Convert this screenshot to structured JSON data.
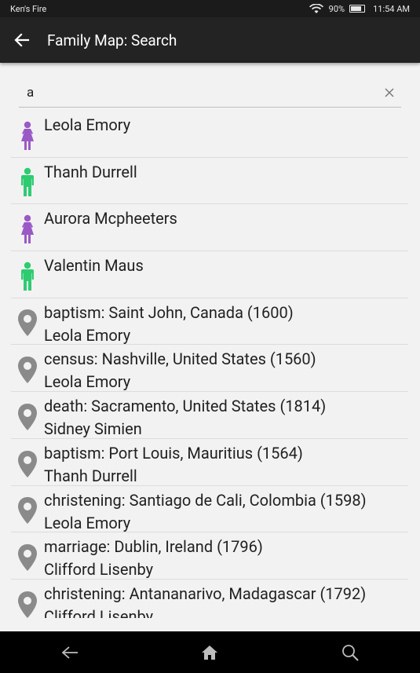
{
  "status_bar": {
    "carrier": "Ken's Fire",
    "battery": "90%",
    "time": "11:54 AM"
  },
  "app_bar": {
    "title": "Family Map: Search"
  },
  "search": {
    "value": "a"
  },
  "colors": {
    "female": "#9b59c6",
    "male": "#2ecc71",
    "event": "#8a8a8a"
  },
  "results": [
    {
      "kind": "female",
      "line1": "Leola Emory",
      "line2": ""
    },
    {
      "kind": "male",
      "line1": "Thanh Durrell",
      "line2": ""
    },
    {
      "kind": "female",
      "line1": "Aurora Mcpheeters",
      "line2": ""
    },
    {
      "kind": "male",
      "line1": "Valentin Maus",
      "line2": ""
    },
    {
      "kind": "event",
      "line1": "baptism: Saint John, Canada (1600)",
      "line2": "Leola Emory"
    },
    {
      "kind": "event",
      "line1": "census: Nashville, United States (1560)",
      "line2": "Leola Emory"
    },
    {
      "kind": "event",
      "line1": "death: Sacramento, United States (1814)",
      "line2": "Sidney Simien"
    },
    {
      "kind": "event",
      "line1": "baptism: Port Louis, Mauritius (1564)",
      "line2": "Thanh Durrell"
    },
    {
      "kind": "event",
      "line1": "christening: Santiago de Cali, Colombia (1598)",
      "line2": "Leola Emory"
    },
    {
      "kind": "event",
      "line1": "marriage: Dublin, Ireland (1796)",
      "line2": "Clifford Lisenby"
    },
    {
      "kind": "event",
      "line1": "christening: Antananarivo, Madagascar (1792)",
      "line2": "Clifford Lisenby"
    }
  ]
}
